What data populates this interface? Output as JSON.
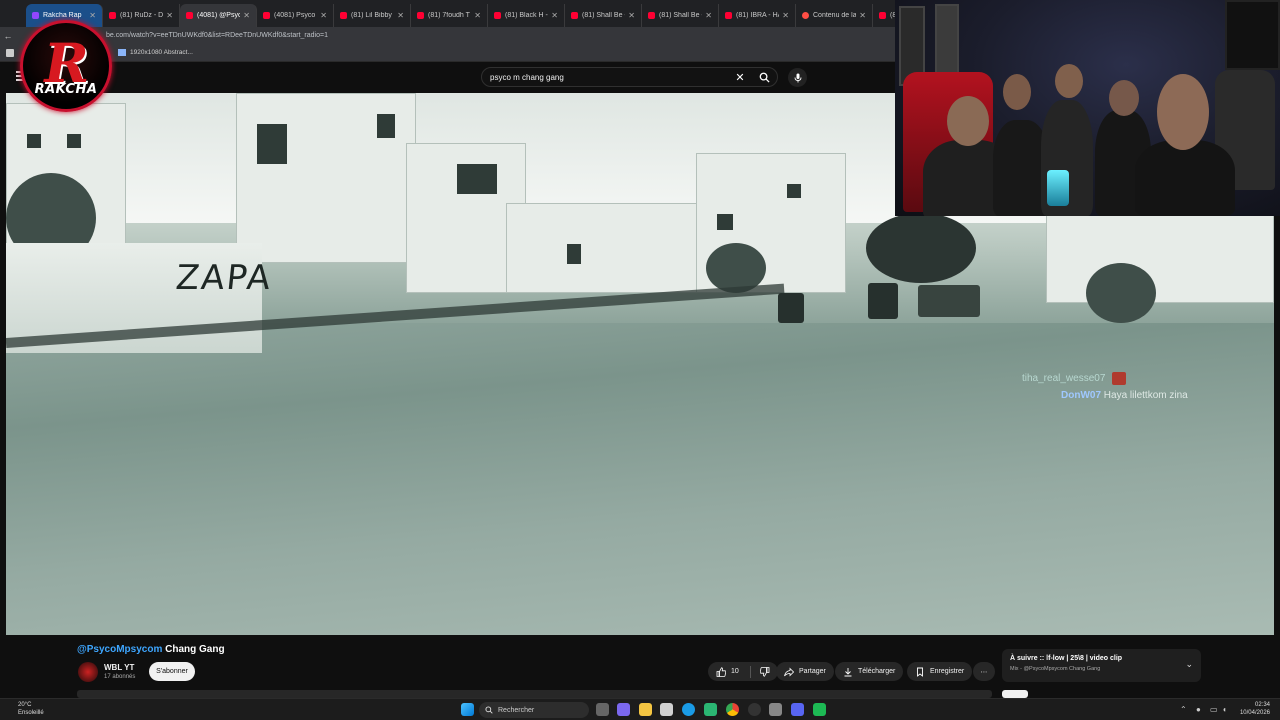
{
  "browser": {
    "tabs": [
      {
        "label": "Rakcha Rap",
        "kind": "twitch"
      },
      {
        "label": "(81) RuDz - Do",
        "kind": "yt"
      },
      {
        "label": "(4081) @Psyco",
        "kind": "yt"
      },
      {
        "label": "(4081) Psyco m",
        "kind": "yt"
      },
      {
        "label": "(81) Lil Bibby F",
        "kind": "yt"
      },
      {
        "label": "(81) 7foudh T",
        "kind": "yt"
      },
      {
        "label": "(81) Black H - L",
        "kind": "yt"
      },
      {
        "label": "(81) Shall Be -",
        "kind": "yt"
      },
      {
        "label": "(81) Shall Be - T",
        "kind": "yt"
      },
      {
        "label": "(81) IBRA - HA",
        "kind": "yt"
      },
      {
        "label": "Contenu de la",
        "kind": "studio"
      },
      {
        "label": "(81) l",
        "kind": "yt"
      }
    ],
    "url": "be.com/watch?v=eeTDnUWKdf0&list=RDeeTDnUWKdf0&start_radio=1",
    "bookmark": "1920x1080 Abstract..."
  },
  "youtube": {
    "search_query": "psyco m chang gang",
    "video": {
      "graffiti": "ZAPA",
      "chat": [
        {
          "user": "tiha_real_wesse07",
          "message": ""
        },
        {
          "user": "DonW07",
          "message": "Haya lilettkom zina"
        }
      ]
    },
    "title_handle": "@PsycoMpsycom",
    "title_rest": " Chang Gang",
    "channel": {
      "name": "WBL YT",
      "subscribers": "17 abonnés",
      "subscribe_label": "S'abonner"
    },
    "actions": {
      "likes": "10",
      "share": "Partager",
      "download": "Télécharger",
      "save": "Enregistrer",
      "more": "⋯"
    },
    "up_next": {
      "title": "À suivre :: ǀf-low | 25\\8 | video clip",
      "subtitle": "Mix - @PsycoMpsycom Chang Gang"
    }
  },
  "overlay": {
    "logo_letter": "R",
    "logo_name": "RAKCHA"
  },
  "taskbar": {
    "temperature": "20°C",
    "weather": "Ensoleillé",
    "search_placeholder": "Rechercher",
    "time": "02:34",
    "date": "10/04/2026"
  },
  "colors": {
    "accent": "#3ea6ff",
    "brand_red": "#d71920",
    "youtube_red": "#ff0033"
  }
}
